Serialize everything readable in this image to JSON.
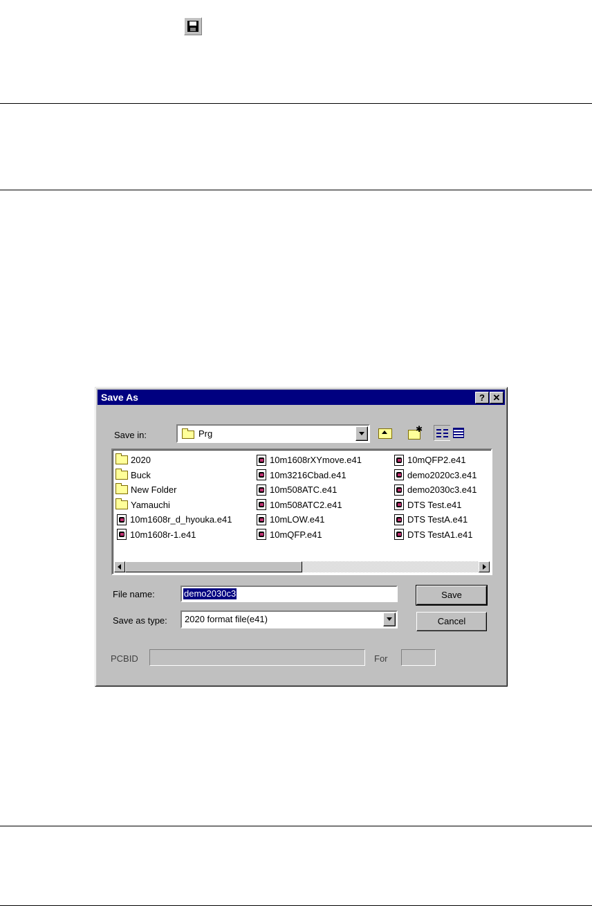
{
  "dialog": {
    "title": "Save As",
    "help_button": "?",
    "close_button": "✕",
    "save_in_label": "Save in:",
    "save_in_value": "Prg",
    "files": {
      "column1": [
        {
          "name": "2020",
          "kind": "folder"
        },
        {
          "name": "Buck",
          "kind": "folder"
        },
        {
          "name": "New Folder",
          "kind": "folder"
        },
        {
          "name": "Yamauchi",
          "kind": "folder"
        },
        {
          "name": "10m1608r_d_hyouka.e41",
          "kind": "file"
        },
        {
          "name": "10m1608r-1.e41",
          "kind": "file"
        }
      ],
      "column2": [
        {
          "name": "10m1608rXYmove.e41",
          "kind": "file"
        },
        {
          "name": "10m3216Cbad.e41",
          "kind": "file"
        },
        {
          "name": "10m508ATC.e41",
          "kind": "file"
        },
        {
          "name": "10m508ATC2.e41",
          "kind": "file"
        },
        {
          "name": "10mLOW.e41",
          "kind": "file"
        },
        {
          "name": "10mQFP.e41",
          "kind": "file"
        }
      ],
      "column3": [
        {
          "name": "10mQFP2.e41",
          "kind": "file"
        },
        {
          "name": "demo2020c3.e41",
          "kind": "file"
        },
        {
          "name": "demo2030c3.e41",
          "kind": "file"
        },
        {
          "name": "DTS Test.e41",
          "kind": "file"
        },
        {
          "name": "DTS TestA.e41",
          "kind": "file"
        },
        {
          "name": "DTS TestA1.e41",
          "kind": "file"
        }
      ]
    },
    "file_name_label": "File name:",
    "file_name_value": "demo2030c3",
    "save_as_type_label": "Save as type:",
    "save_as_type_value": "2020 format file(e41)",
    "save_button": "Save",
    "cancel_button": "Cancel",
    "pcbid_label": "PCBID",
    "for_label": "For"
  }
}
